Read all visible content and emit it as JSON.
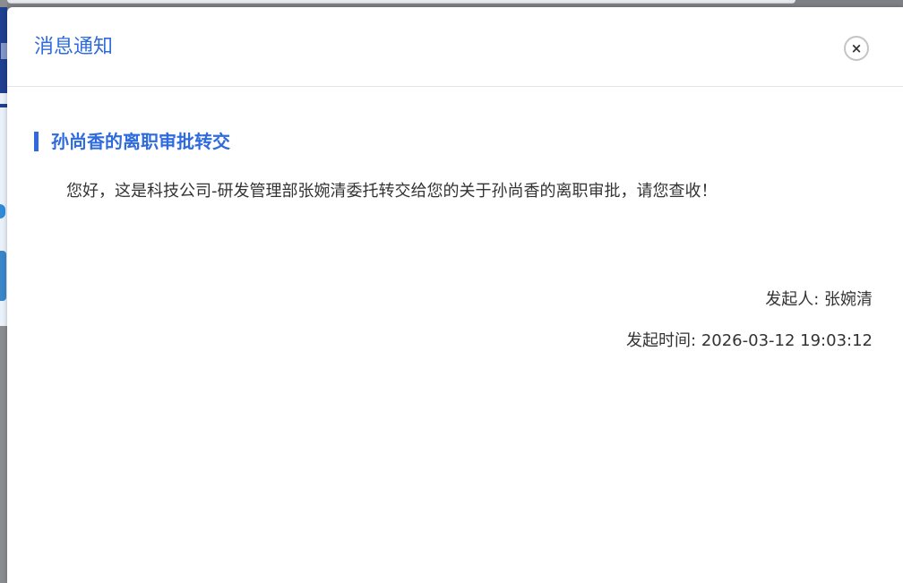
{
  "dialog": {
    "title": "消息通知",
    "close_icon": "close-icon",
    "close_glyph": "×"
  },
  "message": {
    "heading": "孙尚香的离职审批转交",
    "body": "您好，这是科技公司-研发管理部张婉清委托转交给您的关于孙尚香的离职审批，请您查收！",
    "initiator_label": "发起人: ",
    "initiator": "张婉清",
    "time_label": "发起时间: ",
    "time": "2026-03-12 19:03:12"
  },
  "colors": {
    "accent": "#2f6bdc",
    "text": "#333333",
    "divider": "#e3e5e8"
  }
}
